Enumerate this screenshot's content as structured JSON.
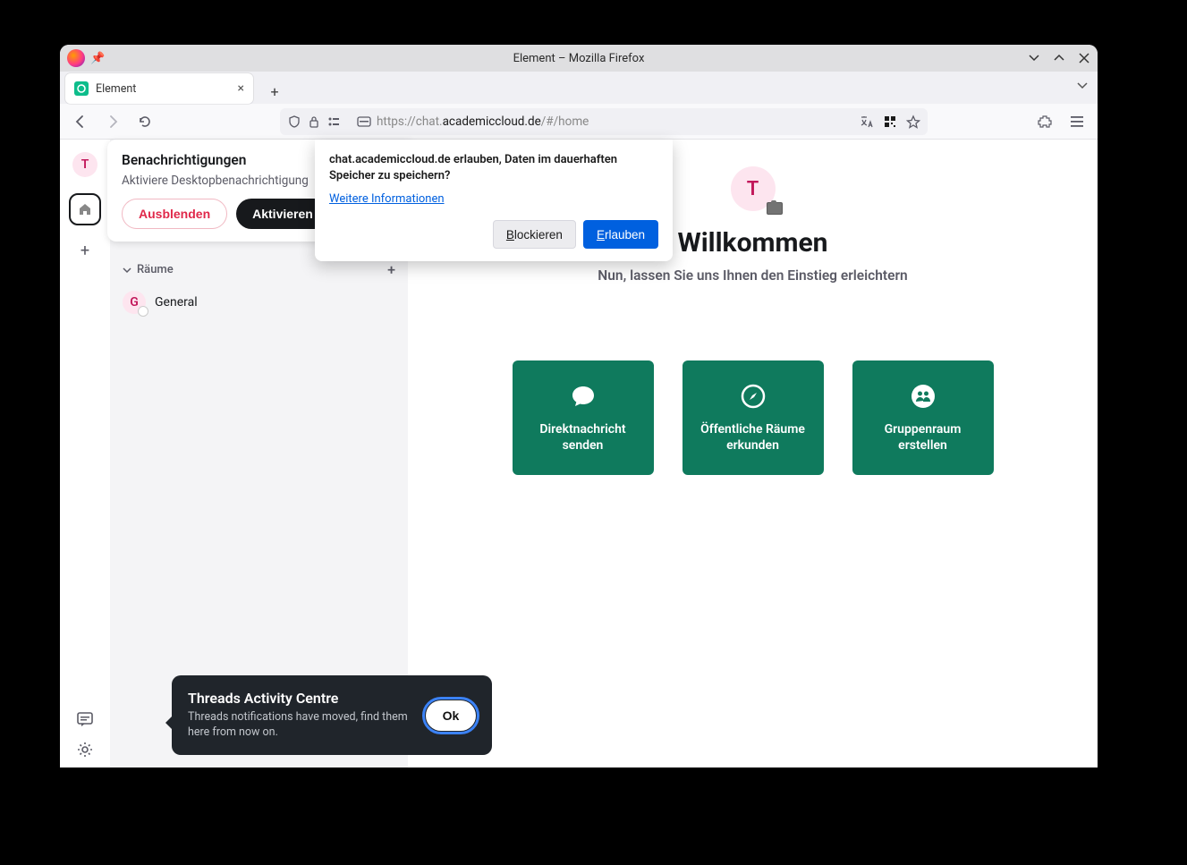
{
  "window_title": "Element – Mozilla Firefox",
  "tab": {
    "title": "Element"
  },
  "url": {
    "prefix": "https://chat.",
    "host": "academiccloud.de",
    "suffix": "/#/home"
  },
  "rail": {
    "avatar_letter": "T"
  },
  "notif_card": {
    "title": "Benachrichtigungen",
    "subtitle": "Aktiviere Desktopbenachrichtigung",
    "hide": "Ausblenden",
    "activate": "Aktivieren"
  },
  "rooms": {
    "header": "Räume",
    "items": [
      {
        "initial": "G",
        "name": "General"
      }
    ]
  },
  "welcome": {
    "avatar_letter": "T",
    "title": "Willkommen",
    "subtitle": "Nun, lassen Sie uns Ihnen den Einstieg erleichtern"
  },
  "cards": {
    "dm": "Direktnachricht senden",
    "explore": "Öffentliche Räume erkunden",
    "group": "Gruppenraum erstellen"
  },
  "perm": {
    "message": "chat.academiccloud.de erlauben, Daten im dauerhaften Speicher zu speichern?",
    "more": "Weitere Informationen",
    "block_pre": "B",
    "block_rest": "lockieren",
    "allow_pre": "E",
    "allow_rest": "rlauben"
  },
  "toast": {
    "title": "Threads Activity Centre",
    "body": "Threads notifications have moved, find them here from now on.",
    "ok": "Ok"
  }
}
